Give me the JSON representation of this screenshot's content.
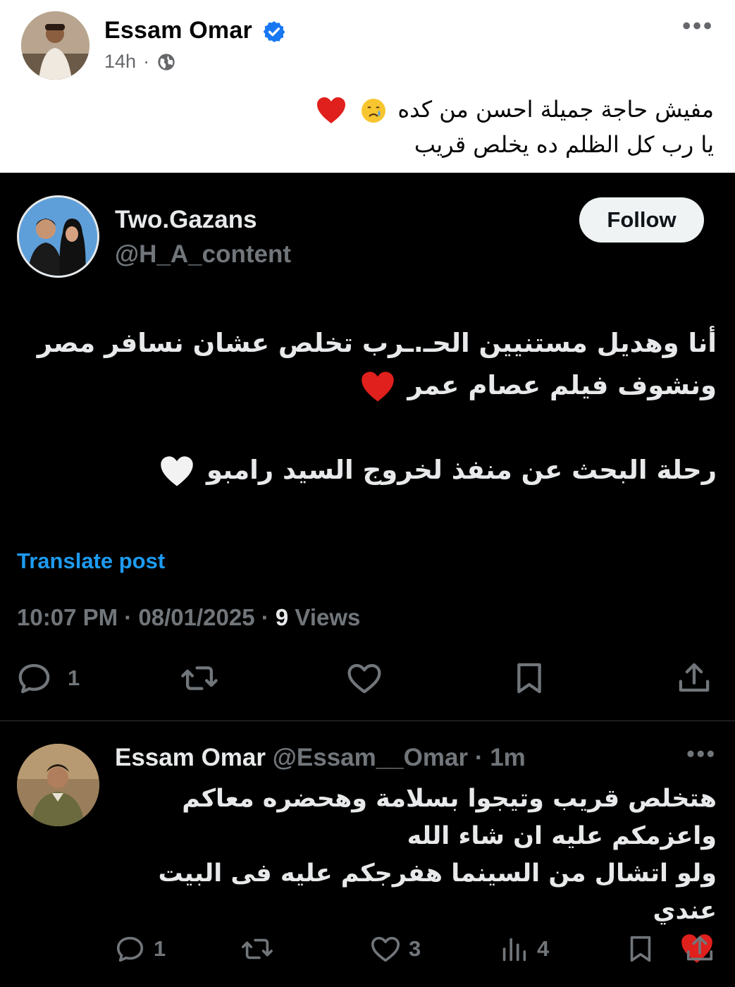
{
  "facebook": {
    "author_name": "Essam Omar",
    "time": "14h",
    "dot": "·",
    "text_line1": "مفيش حاجة جميلة احسن من كده",
    "text_line2": "يا رب كل الظلم ده يخلص قريب",
    "more": "•••"
  },
  "tweet": {
    "name": "Two.Gazans",
    "handle": "@H_A_content",
    "follow_label": "Follow",
    "line1": "أنا وهديل مستنيين الحـ.ـرب تخلص عشان نسافر مصر",
    "line2": "ونشوف فيلم عصام عمر",
    "line3": "رحلة البحث عن منفذ لخروج السيد رامبو",
    "translate_label": "Translate post",
    "timestamp": "10:07 PM · 08/01/2025 · ",
    "views_count": "9",
    "views_label": " Views",
    "reply_count": "1"
  },
  "reply": {
    "name": "Essam Omar",
    "handle_time": " @Essam__Omar · 1m",
    "more": "•••",
    "line1": "هتخلص قريب وتيجوا بسلامة وهحضره معاكم",
    "line2": "واعزمكم عليه ان شاء الله",
    "line3": "ولو اتشال من السينما هفرجكم عليه فى البيت عندي",
    "reply_count": "1",
    "like_count": "3",
    "views_count": "4"
  },
  "colors": {
    "x_background": "#000000",
    "link_blue": "#1d9bf0",
    "muted": "#71767b",
    "verified_blue": "#1877f2",
    "heart_red": "#e0201c"
  }
}
